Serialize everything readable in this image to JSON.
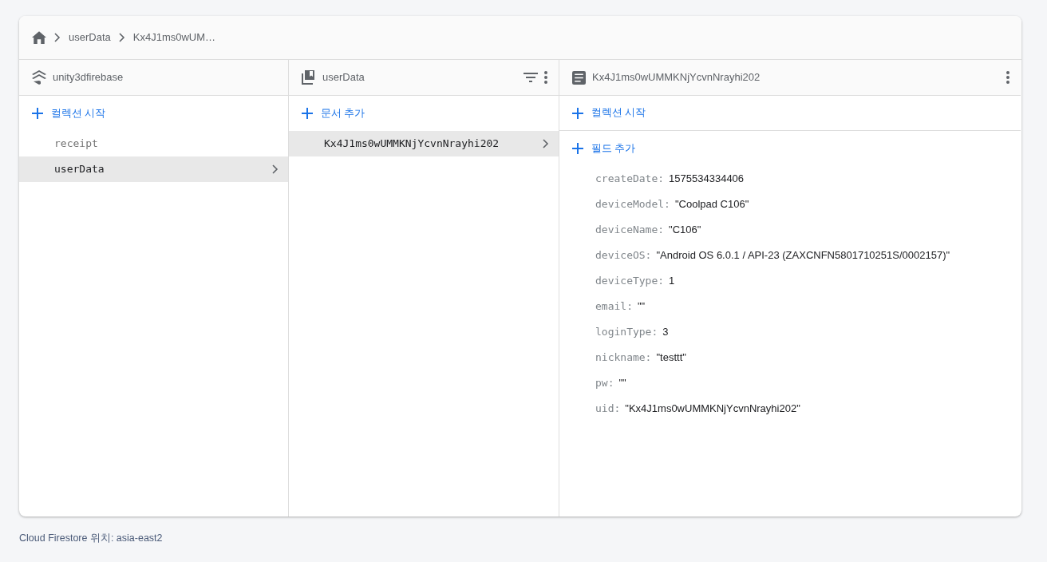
{
  "breadcrumb": [
    "userData",
    "Kx4J1ms0wUM…"
  ],
  "columns": [
    {
      "kind": "root",
      "title": "unity3dfirebase",
      "add_label": "컬렉션 시작",
      "items": [
        {
          "label": "receipt",
          "selected": false
        },
        {
          "label": "userData",
          "selected": true
        }
      ]
    },
    {
      "kind": "collection",
      "title": "userData",
      "add_label": "문서 추가",
      "items": [
        {
          "label": "Kx4J1ms0wUMMKNjYcvnNrayhi202",
          "selected": true
        }
      ]
    },
    {
      "kind": "document",
      "title": "Kx4J1ms0wUMMKNjYcvnNrayhi202",
      "add_label": "컬렉션 시작",
      "field_add_label": "필드 추가",
      "fields": [
        {
          "key": "createDate:",
          "value": "1575534334406"
        },
        {
          "key": "deviceModel:",
          "value": "\"Coolpad C106\""
        },
        {
          "key": "deviceName:",
          "value": "\"C106\""
        },
        {
          "key": "deviceOS:",
          "value": "\"Android OS 6.0.1 / API-23 (ZAXCNFN5801710251S/0002157)\""
        },
        {
          "key": "deviceType:",
          "value": "1"
        },
        {
          "key": "email:",
          "value": "\"\""
        },
        {
          "key": "loginType:",
          "value": "3"
        },
        {
          "key": "nickname:",
          "value": "\"testtt\""
        },
        {
          "key": "pw:",
          "value": "\"\""
        },
        {
          "key": "uid:",
          "value": "\"Kx4J1ms0wUMMKNjYcvnNrayhi202\""
        }
      ]
    }
  ],
  "footer": "Cloud Firestore 위치: asia-east2"
}
